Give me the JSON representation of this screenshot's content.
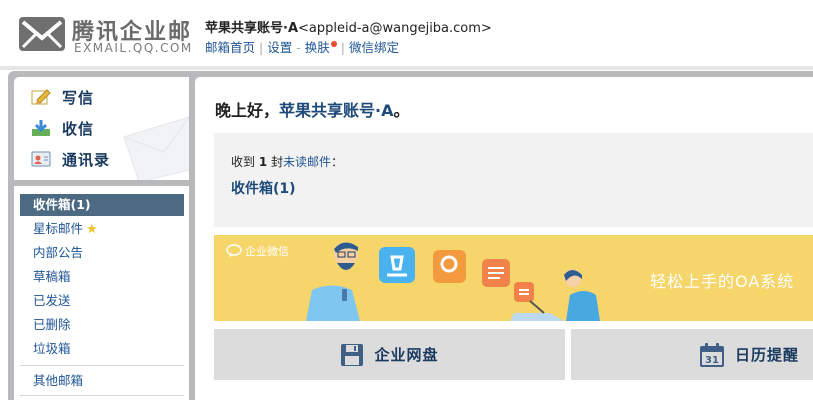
{
  "header": {
    "logo": {
      "title": "腾讯企业邮",
      "subtitle": "EXMAIL.QQ.COM"
    },
    "account": {
      "name": "苹果共享账号·A",
      "email": "<appleid-a@wangejiba.com>"
    },
    "links": [
      {
        "label": "邮箱首页"
      },
      {
        "label": "设置"
      },
      {
        "label": "换肤"
      },
      {
        "label": "微信绑定"
      }
    ],
    "separators": [
      "|",
      "-",
      "|"
    ]
  },
  "actions": [
    {
      "label": "写信",
      "icon": "compose-icon"
    },
    {
      "label": "收信",
      "icon": "receive-icon"
    },
    {
      "label": "通讯录",
      "icon": "contacts-icon"
    }
  ],
  "folders": {
    "main": [
      {
        "label": "收件箱(1)",
        "active": true
      },
      {
        "label": "星标邮件",
        "icon": "star-icon"
      },
      {
        "label": "内部公告"
      },
      {
        "label": "草稿箱"
      },
      {
        "label": "已发送"
      },
      {
        "label": "已删除"
      },
      {
        "label": "垃圾箱"
      }
    ],
    "other": {
      "label": "其他邮箱"
    }
  },
  "main": {
    "greeting": {
      "prefix": "晚上好，",
      "name": "苹果共享账号·A",
      "suffix": "。"
    },
    "unread": {
      "prefix": "收到",
      "count": "1",
      "mid": "封",
      "link": "未读邮件",
      "suffix": "："
    },
    "inbox_link": "收件箱(1)",
    "banner": {
      "brand": "企业微信",
      "slogan": "轻松上手的OA系统",
      "color": "#f6d56a"
    },
    "tiles": [
      {
        "label": "企业网盘",
        "icon": "disk-icon"
      },
      {
        "label": "日历提醒",
        "icon": "calendar-icon",
        "day": "31"
      }
    ]
  },
  "colors": {
    "link": "#1e5494",
    "active_folder": "#4d6a83",
    "frame": "#b8b9ba",
    "notify_dot": "#e8492f"
  }
}
